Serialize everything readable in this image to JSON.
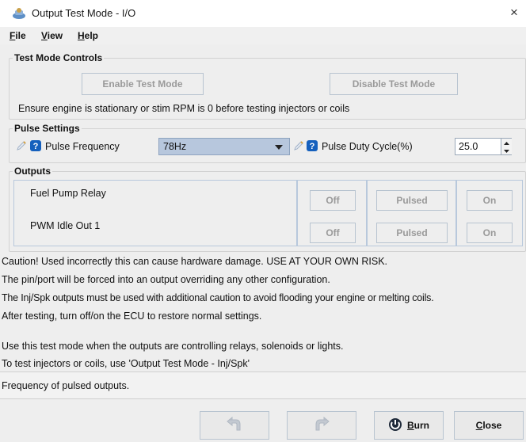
{
  "window": {
    "title": "Output Test Mode - I/O",
    "close_glyph": "×"
  },
  "menu": [
    {
      "mnemonic": "F",
      "rest": "ile"
    },
    {
      "mnemonic": "V",
      "rest": "iew"
    },
    {
      "mnemonic": "H",
      "rest": "elp"
    }
  ],
  "test_mode": {
    "title": "Test Mode Controls",
    "enable_label": "Enable Test Mode",
    "disable_label": "Disable Test Mode",
    "note": "Ensure engine is stationary or stim RPM is 0 before testing injectors or coils"
  },
  "pulse": {
    "title": "Pulse Settings",
    "frequency_label": "Pulse Frequency",
    "frequency_value": "78Hz",
    "duty_label": "Pulse Duty Cycle(%)",
    "duty_value": "25.0"
  },
  "outputs": {
    "title": "Outputs",
    "rows": [
      {
        "name": "Fuel Pump Relay",
        "off": "Off",
        "pulsed": "Pulsed",
        "on": "On"
      },
      {
        "name": "PWM Idle Out 1",
        "off": "Off",
        "pulsed": "Pulsed",
        "on": "On"
      }
    ]
  },
  "warnings": [
    "Caution! Used incorrectly this can cause hardware damage. USE AT YOUR OWN RISK.",
    "The pin/port will be forced into an output overriding any other configuration.",
    "The Inj/Spk outputs must be used with additional caution to avoid flooding your engine or melting coils.",
    "After testing, turn off/on the ECU to restore normal settings.",
    "Use this test mode when the outputs are controlling relays, solenoids or lights.",
    "To test injectors or coils, use 'Output Test Mode - Inj/Spk'"
  ],
  "status": "Frequency of pulsed outputs.",
  "bottom": {
    "burn_mnemonic": "B",
    "burn_rest": "urn",
    "close_mnemonic": "C",
    "close_rest": "lose"
  },
  "icons": {
    "help": "question-mark-icon",
    "edit": "pencil-icon",
    "undo": "undo-icon",
    "redo": "redo-icon",
    "burn": "burn-icon",
    "app": "app-icon"
  },
  "colors": {
    "combo_bg": "#b7c7dd",
    "help_blue": "#1560bd",
    "disabled_text": "#9a9a9a"
  }
}
